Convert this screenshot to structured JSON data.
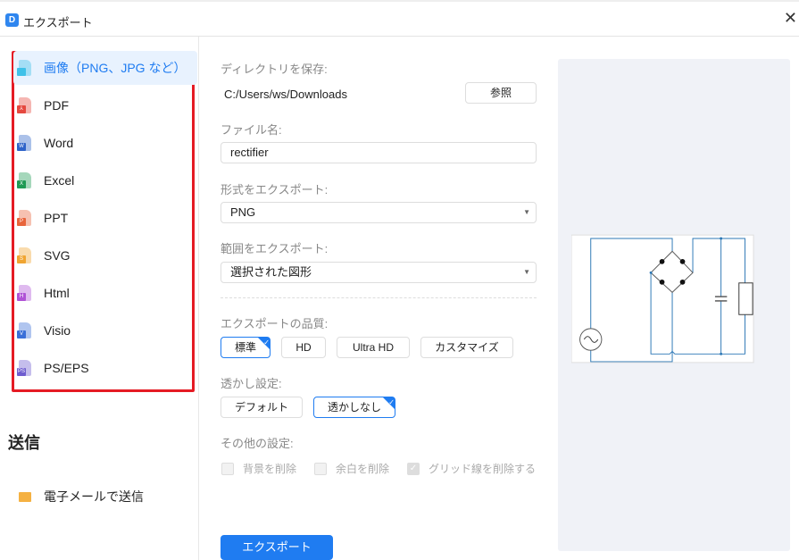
{
  "window": {
    "title": "エクスポート",
    "app_icon": "D"
  },
  "sidebar": {
    "formats": [
      {
        "label": "画像（PNG、JPG など）",
        "color": "#3fc1e8",
        "badge": ""
      },
      {
        "label": "PDF",
        "color": "#e5483f",
        "badge": "⅄"
      },
      {
        "label": "Word",
        "color": "#2e63c9",
        "badge": "W"
      },
      {
        "label": "Excel",
        "color": "#1f9a55",
        "badge": "X"
      },
      {
        "label": "PPT",
        "color": "#e8643b",
        "badge": "P"
      },
      {
        "label": "SVG",
        "color": "#f0a531",
        "badge": "S"
      },
      {
        "label": "Html",
        "color": "#b052d6",
        "badge": "H"
      },
      {
        "label": "Visio",
        "color": "#3a6fd8",
        "badge": "V"
      },
      {
        "label": "PS/EPS",
        "color": "#6e5ccf",
        "badge": "PS"
      }
    ],
    "send_heading": "送信",
    "email_label": "電子メールで送信"
  },
  "form": {
    "dir_label": "ディレクトリを保存:",
    "dir_value": "C:/Users/ws/Downloads",
    "browse": "参照",
    "filename_label": "ファイル名:",
    "filename_value": "rectifier",
    "format_label": "形式をエクスポート:",
    "format_value": "PNG",
    "range_label": "範囲をエクスポート:",
    "range_value": "選択された図形",
    "quality_label": "エクスポートの品質:",
    "quality_options": [
      "標準",
      "HD",
      "Ultra HD",
      "カスタマイズ"
    ],
    "quality_selected": "標準",
    "watermark_label": "透かし設定:",
    "watermark_options": [
      "デフォルト",
      "透かしなし"
    ],
    "watermark_selected": "透かしなし",
    "other_label": "その他の設定:",
    "other_options": [
      {
        "label": "背景を削除",
        "checked": false
      },
      {
        "label": "余白を削除",
        "checked": false
      },
      {
        "label": "グリッド線を削除する",
        "checked": true
      }
    ],
    "export_button": "エクスポート"
  },
  "colors": {
    "accent": "#1f7cf1",
    "highlight": "#e51b24"
  }
}
